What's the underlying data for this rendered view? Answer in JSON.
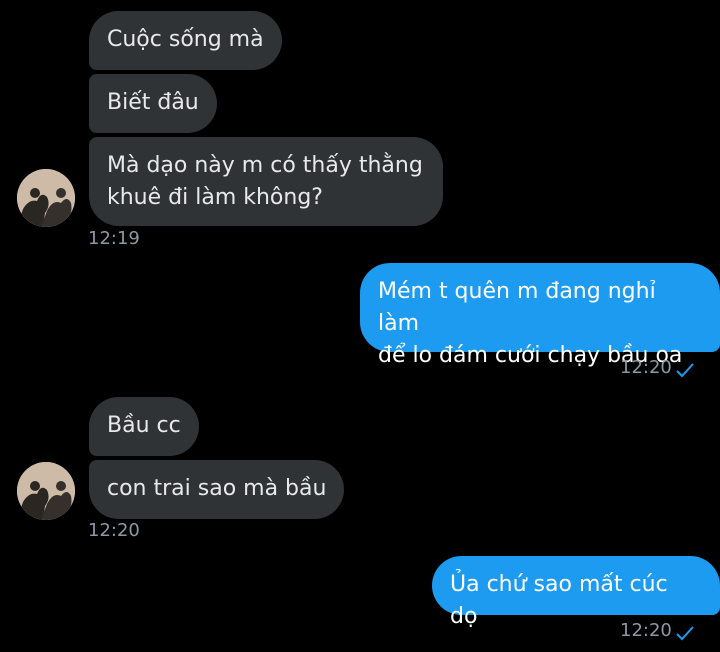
{
  "colors": {
    "background": "#000000",
    "incoming_bubble": "#2f3336",
    "outgoing_bubble": "#1d9bf0",
    "timestamp": "#8b98a5",
    "check": "#1d9bf0"
  },
  "messages": [
    {
      "direction": "incoming",
      "text": "Cuộc sống mà"
    },
    {
      "direction": "incoming",
      "text": "Biết đâu"
    },
    {
      "direction": "incoming",
      "text": "Mà dạo này m có thấy thằng\nkhuê đi làm không?"
    },
    {
      "direction": "outgoing",
      "text": "Mém t quên m đang nghỉ làm\nđể lo đám cưới chạy bầu oa"
    },
    {
      "direction": "incoming",
      "text": "Bầu cc"
    },
    {
      "direction": "incoming",
      "text": "con trai sao mà bầu"
    },
    {
      "direction": "outgoing",
      "text": "Ủa chứ sao mất cúc dọ"
    }
  ],
  "timestamps": {
    "group1": "12:19",
    "group2": "12:20",
    "group3": "12:20",
    "group4": "12:20"
  },
  "icons": {
    "avatar": "avatar-icon",
    "read_check": "checkmark-icon"
  }
}
